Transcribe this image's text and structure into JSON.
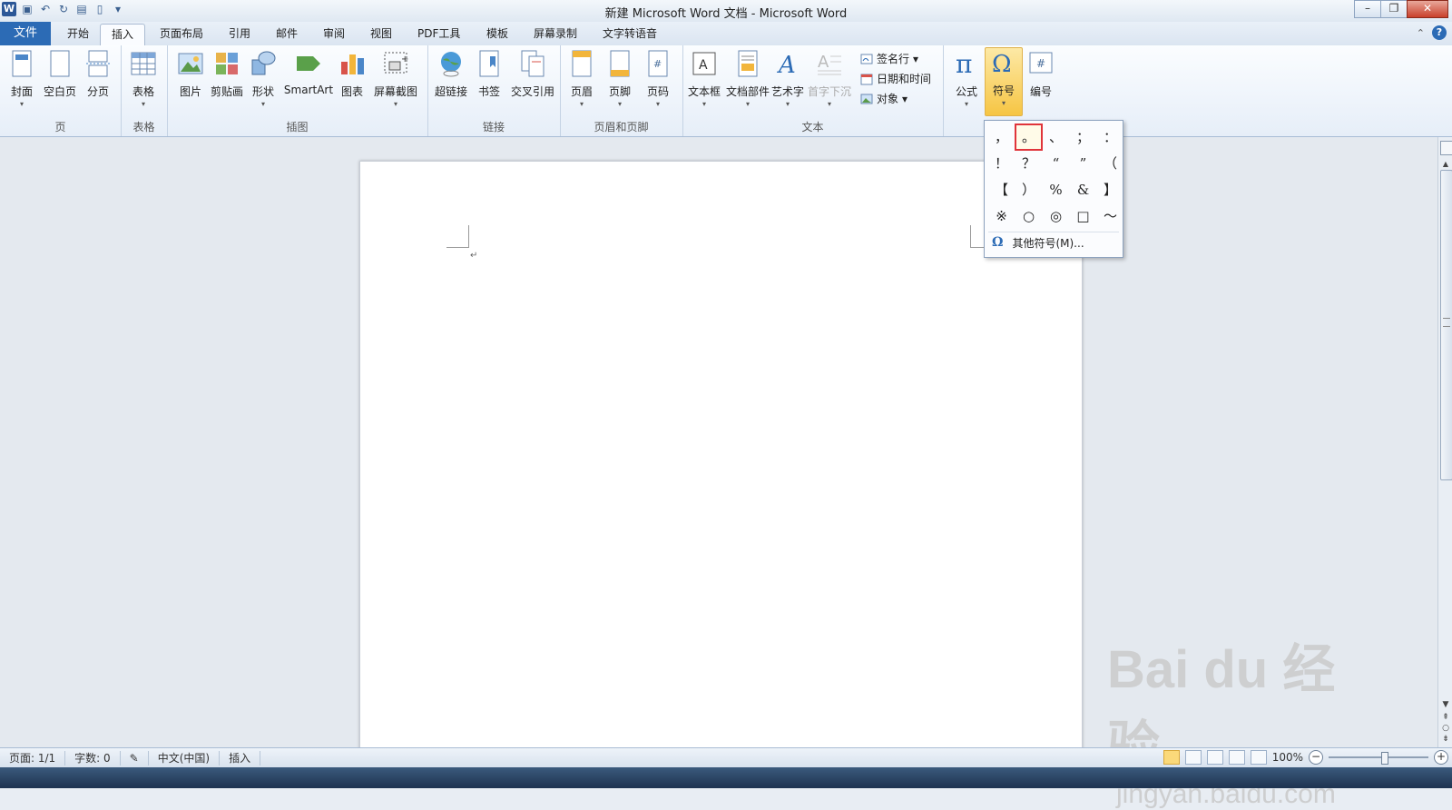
{
  "window": {
    "title": "新建 Microsoft Word 文档 - Microsoft Word",
    "app_icon": "W",
    "controls": [
      "–",
      "❐",
      "✕"
    ]
  },
  "tabs": [
    {
      "id": "file",
      "label": "文件"
    },
    {
      "id": "home",
      "label": "开始"
    },
    {
      "id": "insert",
      "label": "插入",
      "active": true
    },
    {
      "id": "layout",
      "label": "页面布局"
    },
    {
      "id": "references",
      "label": "引用"
    },
    {
      "id": "mailings",
      "label": "邮件"
    },
    {
      "id": "review",
      "label": "审阅"
    },
    {
      "id": "view",
      "label": "视图"
    },
    {
      "id": "pdf",
      "label": "PDF工具"
    },
    {
      "id": "template",
      "label": "模板"
    },
    {
      "id": "screenrec",
      "label": "屏幕录制"
    },
    {
      "id": "tts",
      "label": "文字转语音"
    }
  ],
  "ribbon": {
    "groups": {
      "pages": {
        "label": "页",
        "buttons": [
          "封面",
          "空白页",
          "分页"
        ]
      },
      "tables": {
        "label": "表格",
        "buttons": [
          "表格"
        ]
      },
      "illustrations": {
        "label": "插图",
        "buttons": [
          "图片",
          "剪贴画",
          "形状",
          "SmartArt",
          "图表",
          "屏幕截图"
        ]
      },
      "links": {
        "label": "链接",
        "buttons": [
          "超链接",
          "书签",
          "交叉引用"
        ]
      },
      "header_footer": {
        "label": "页眉和页脚",
        "buttons": [
          "页眉",
          "页脚",
          "页码"
        ]
      },
      "text": {
        "label": "文本",
        "buttons": [
          "文本框",
          "文档部件",
          "艺术字",
          "首字下沉"
        ],
        "small": [
          "签名行",
          "日期和时间",
          "对象"
        ]
      },
      "symbols": {
        "buttons": [
          "公式",
          "符号",
          "编号"
        ]
      }
    }
  },
  "symbol_menu": {
    "symbols": [
      "，",
      "。",
      "、",
      "；",
      "：",
      "！",
      "？",
      "“",
      "”",
      "（",
      "【",
      "）",
      "%",
      "&",
      "】",
      "※",
      "○",
      "◎",
      "□",
      "～"
    ],
    "highlighted_index": 1,
    "more_label": "其他符号(M)..."
  },
  "statusbar": {
    "page": "页面: 1/1",
    "words": "字数: 0",
    "language": "中文(中国)",
    "mode": "插入",
    "zoom": "100%"
  },
  "watermark": {
    "main": "Bai du 经验",
    "sub": "jingyan.baidu.com"
  },
  "colors": {
    "file_tab": "#2c6bb5",
    "symbol_highlight": "#e0343a",
    "selected_button": "#f6c543"
  }
}
